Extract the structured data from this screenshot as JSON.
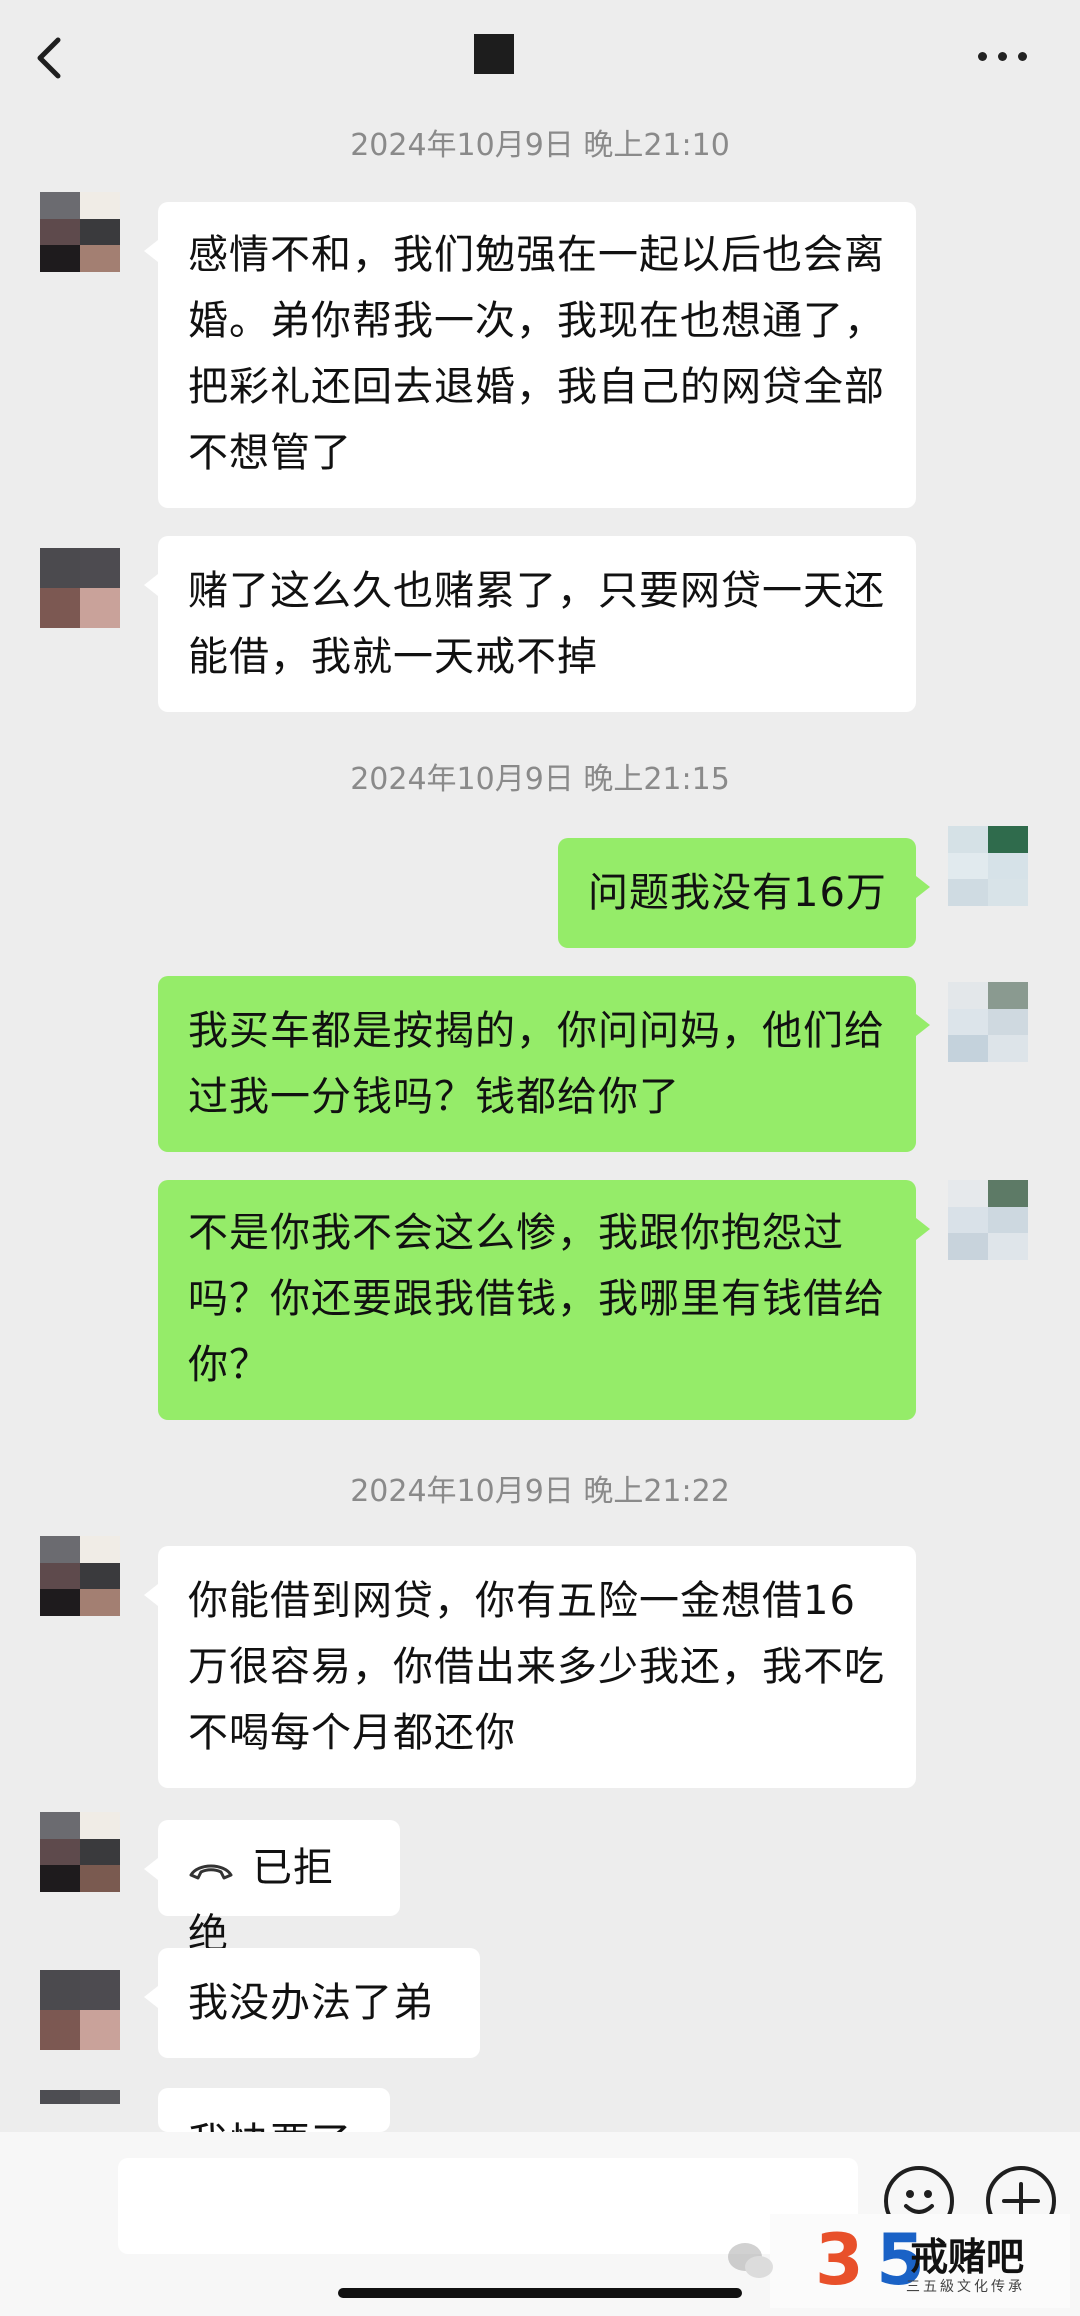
{
  "header": {
    "back_icon": "chevron-left-icon",
    "more_icon": "ellipsis-icon"
  },
  "messages": [
    {
      "type": "timestamp",
      "text": "2024年10月9日 晚上21:10"
    },
    {
      "type": "received",
      "text": "感情不和，我们勉强在一起以后也会离婚。弟你帮我一次，我现在也想通了，把彩礼还回去退婚，我自己的网贷全部不想管了"
    },
    {
      "type": "received",
      "text": "赌了这么久也赌累了，只要网贷一天还能借，我就一天戒不掉"
    },
    {
      "type": "timestamp",
      "text": "2024年10月9日 晚上21:15"
    },
    {
      "type": "sent",
      "text": "问题我没有16万"
    },
    {
      "type": "sent",
      "text": "我买车都是按揭的，你问问妈，他们给过我一分钱吗？钱都给你了"
    },
    {
      "type": "sent",
      "text": "不是你我不会这么惨，我跟你抱怨过吗？你还要跟我借钱，我哪里有钱借给你？"
    },
    {
      "type": "timestamp",
      "text": "2024年10月9日 晚上21:22"
    },
    {
      "type": "received",
      "text": "你能借到网贷，你有五险一金想借16万很容易，你借出来多少我还，我不吃不喝每个月都还你"
    },
    {
      "type": "received-call",
      "text": "已拒绝",
      "icon": "phone-hangup-icon"
    },
    {
      "type": "received",
      "text": "我没办法了弟"
    },
    {
      "type": "received-partial",
      "text": "我快要了"
    }
  ],
  "bottom_bar": {
    "input_value": "",
    "emoji_icon": "emoji-icon",
    "plus_icon": "plus-icon"
  },
  "watermark": {
    "logo_text": "35",
    "name": "戒赌吧",
    "subtitle": "三五級文化传承"
  },
  "colors": {
    "background": "#ededed",
    "sent_bubble": "#95ec69",
    "received_bubble": "#ffffff"
  }
}
